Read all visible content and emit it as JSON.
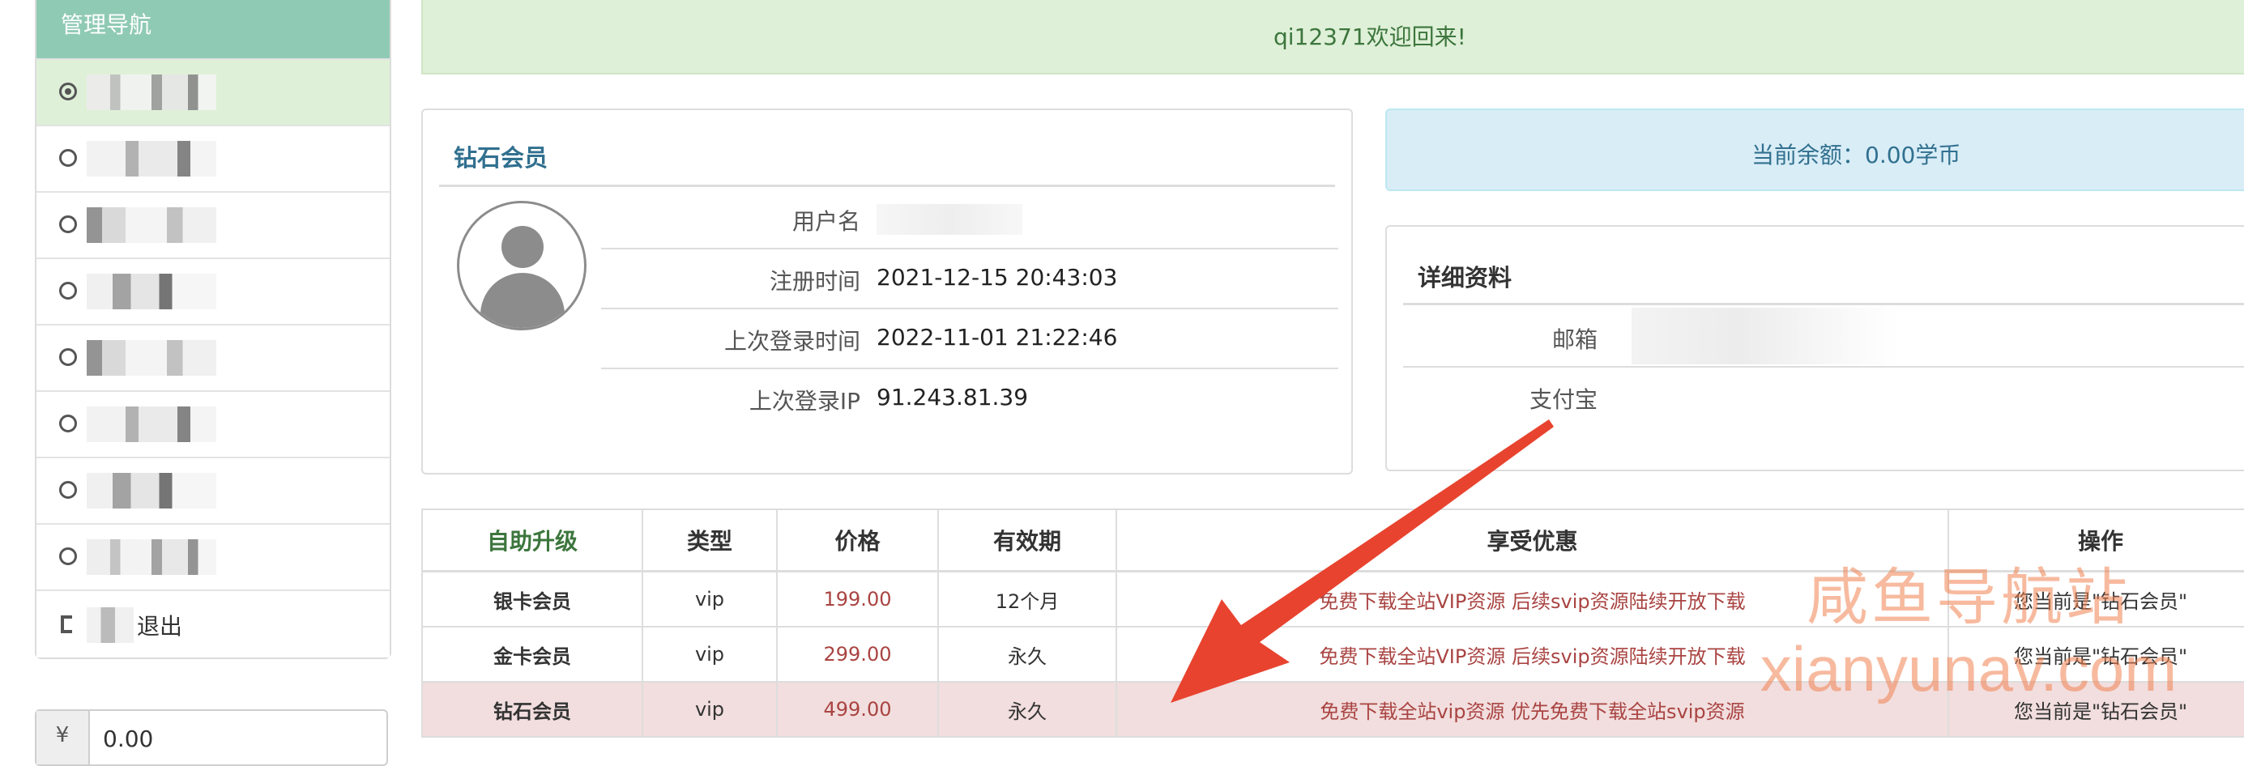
{
  "sidebar": {
    "header": "管理导航",
    "logout_label": "退出"
  },
  "amount": {
    "currency_symbol": "¥",
    "value": "0.00"
  },
  "welcome": "qi12371欢迎回来!",
  "profile": {
    "title": "钻石会员",
    "rows": [
      {
        "label": "用户名",
        "value": ""
      },
      {
        "label": "注册时间",
        "value": "2021-12-15 20:43:03"
      },
      {
        "label": "上次登录时间",
        "value": "2022-11-01 21:22:46"
      },
      {
        "label": "上次登录IP",
        "value": "91.243.81.39"
      }
    ]
  },
  "balance": "当前余额：0.00学币",
  "details": {
    "title": "详细资料",
    "rows": [
      {
        "label": "邮箱"
      },
      {
        "label": "支付宝"
      }
    ]
  },
  "upgrade": {
    "headers": [
      "自助升级",
      "类型",
      "价格",
      "有效期",
      "享受优惠",
      "操作"
    ],
    "rows": [
      {
        "name": "银卡会员",
        "type": "vip",
        "price": "199.00",
        "period": "12个月",
        "benefit": "免费下载全站VIP资源 后续svip资源陆续开放下载",
        "action": "您当前是\"钻石会员\""
      },
      {
        "name": "金卡会员",
        "type": "vip",
        "price": "299.00",
        "period": "永久",
        "benefit": "免费下载全站VIP资源 后续svip资源陆续开放下载",
        "action": "您当前是\"钻石会员\""
      },
      {
        "name": "钻石会员",
        "type": "vip",
        "price": "499.00",
        "period": "永久",
        "benefit": "免费下载全站vip资源 优先免费下载全站svip资源",
        "action": "您当前是\"钻石会员\""
      }
    ]
  },
  "watermark": {
    "cn": "咸鱼导航站",
    "en": "xianyunav.com"
  },
  "colors": {
    "nav_header": "#8fcab5",
    "success_bg": "#dff0d8",
    "info_bg": "#d9edf7",
    "danger_text": "#a94442",
    "arrow": "#e8432f"
  }
}
